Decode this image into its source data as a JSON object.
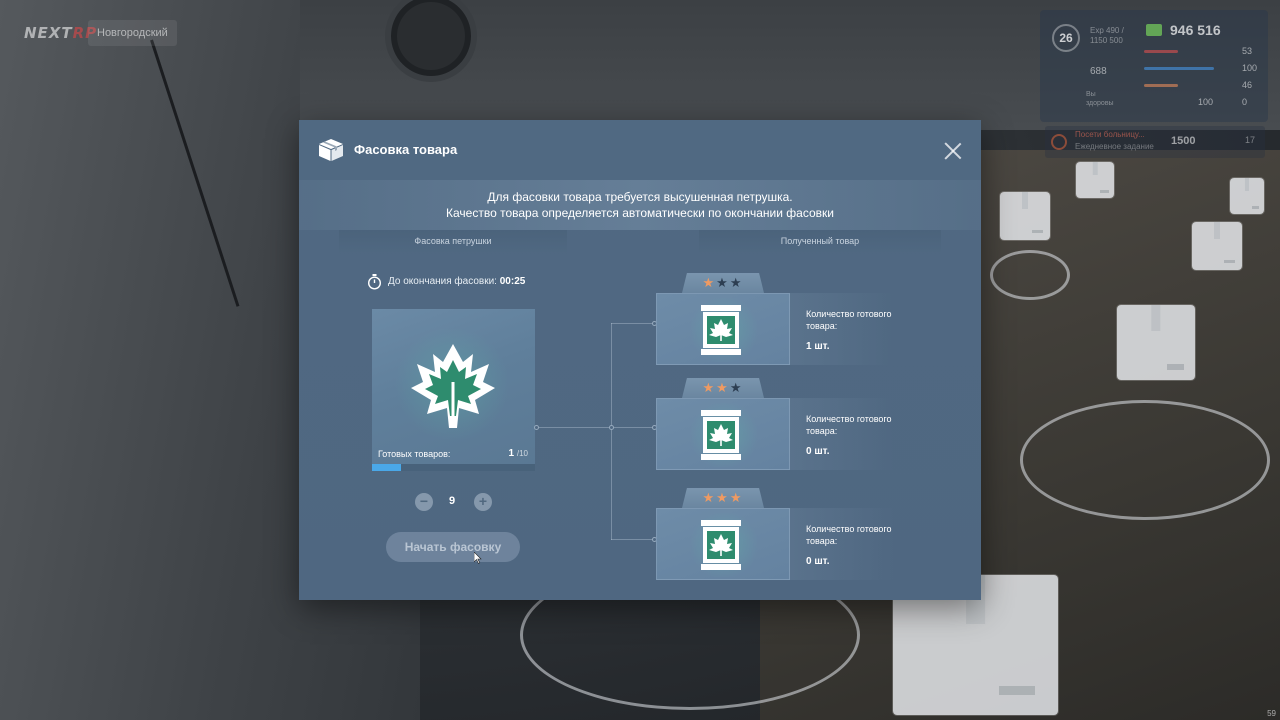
{
  "hud": {
    "logo_main": "NEXT",
    "logo_suffix": "RP",
    "server": "Новгородский",
    "level": "26",
    "exp_top": "Exp 490 /",
    "exp_bottom": "1150 500",
    "money": "946 516",
    "stat_hunger": "53",
    "stat_run": "100",
    "stat_water": "46",
    "stat_armor": "0",
    "stat_car": "688",
    "stat_health_label": "Вы",
    "stat_health_sub": "здоровы",
    "stat_hp": "100",
    "quest_title": "Посети больницу...",
    "quest_sub": "Ежедневное задание",
    "quest_reward": "1500",
    "quest_count": "17",
    "fps": "59"
  },
  "modal": {
    "title": "Фасовка товара",
    "info_line1": "Для фасовки товара требуется высушенная петрушка.",
    "info_line2": "Качество товара определяется автоматически по окончании фасовки",
    "left_column_title": "Фасовка петрушки",
    "right_column_title": "Полученный товар",
    "timer_label": "До окончания фасовки:",
    "timer_value": "00:25",
    "ready_label": "Готовых товаров:",
    "ready_count": "1",
    "ready_max": "/10",
    "ready_progress": 0.18,
    "stepper_minus": "−",
    "stepper_plus": "+",
    "stepper_value": "9",
    "start_button": "Начать фасовку",
    "tiers": [
      {
        "stars_on": 1,
        "label": "Количество готового товара:",
        "quantity": "1 шт."
      },
      {
        "stars_on": 2,
        "label": "Количество готового товара:",
        "quantity": "0 шт."
      },
      {
        "stars_on": 3,
        "label": "Количество готового товара:",
        "quantity": "0 шт."
      }
    ]
  },
  "colors": {
    "accent_progress": "#4aa8e8",
    "star_on": "#ef9a62",
    "star_off": "#2d3e52",
    "icon_green": "#2e8c6e"
  }
}
